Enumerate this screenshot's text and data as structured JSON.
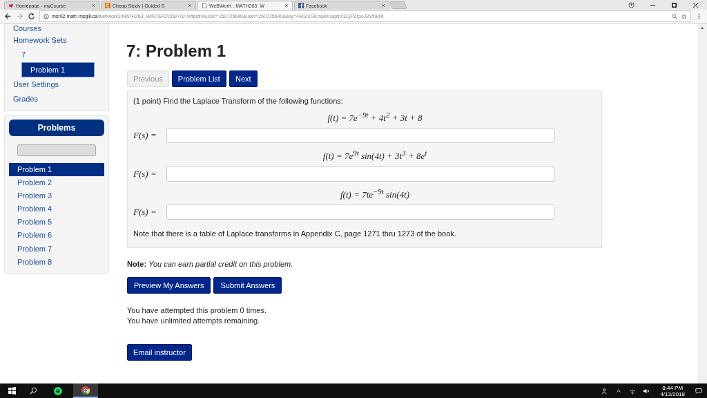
{
  "browser": {
    "tabs": [
      {
        "title": "Homepage - myCourse",
        "kind": "mycourses",
        "selected": false
      },
      {
        "title": "Chegg Study | Guided S",
        "kind": "chegg",
        "selected": false
      },
      {
        "title": "WeBWorK : MATH263_W",
        "kind": "page",
        "selected": true
      },
      {
        "title": "Facebook",
        "kind": "facebook",
        "selected": false
      }
    ],
    "address": {
      "host": "msr02.math.mcgill.ca",
      "path": "/webwork2/MATH263_WINTER2018/7/1/?effectiveUser=260725640&user=260725640&key=4RGr2GKnaAKvuptrX3CjPZrpoJ3Y5aXK"
    }
  },
  "sidebar": {
    "nav": [
      {
        "label": "Courses",
        "selected": false
      },
      {
        "label": "Homework Sets",
        "selected": false,
        "children": [
          {
            "label": "7",
            "selected": false,
            "children": [
              {
                "label": "Problem 1",
                "selected": true
              }
            ]
          }
        ]
      },
      {
        "label": "User Settings",
        "selected": false
      },
      {
        "label": "Grades",
        "selected": false
      }
    ],
    "problems": {
      "title": "Problems",
      "items": [
        {
          "label": "Problem 1",
          "selected": true
        },
        {
          "label": "Problem 2",
          "selected": false
        },
        {
          "label": "Problem 3",
          "selected": false
        },
        {
          "label": "Problem 4",
          "selected": false
        },
        {
          "label": "Problem 5",
          "selected": false
        },
        {
          "label": "Problem 6",
          "selected": false
        },
        {
          "label": "Problem 7",
          "selected": false
        },
        {
          "label": "Problem 8",
          "selected": false
        }
      ]
    }
  },
  "main": {
    "title": "7: Problem 1",
    "nav_buttons": [
      {
        "label": "Previous",
        "disabled": true
      },
      {
        "label": "Problem List",
        "disabled": false
      },
      {
        "label": "Next",
        "disabled": false
      }
    ],
    "problem": {
      "intro": "(1 point) Find the Laplace Transform of the following functions:",
      "parts": [
        {
          "equation": "f(t) = 7e$^{−9t}$ + 4t$^{2}$ + 3t + 8",
          "answer_label": "F(s) ="
        },
        {
          "equation": "f(t) = 7e$^{9t}$ sin(4t) + 3t$^{3}$ + 8e$^{t}$",
          "answer_label": "F(s) ="
        },
        {
          "equation": "f(t) = 7te$^{−9t}$ sin(4t)",
          "answer_label": "F(s) ="
        }
      ],
      "footnote": "Note that there is a table of Laplace transforms in Appendix C, page 1271 thru 1273 of the book."
    },
    "note": "**Note:** *You can earn partial credit on this problem.*",
    "actions": [
      "Preview My Answers",
      "Submit Answers"
    ],
    "attempts": [
      "You have attempted this problem 0 times.",
      "You have unlimited attempts remaining."
    ],
    "email_button": "Email instructor"
  },
  "taskbar": {
    "apps": [
      {
        "kind": "spotify",
        "selected": false
      },
      {
        "kind": "chrome",
        "selected": true
      }
    ],
    "time": "8:44 PM",
    "date": "4/13/2018"
  }
}
